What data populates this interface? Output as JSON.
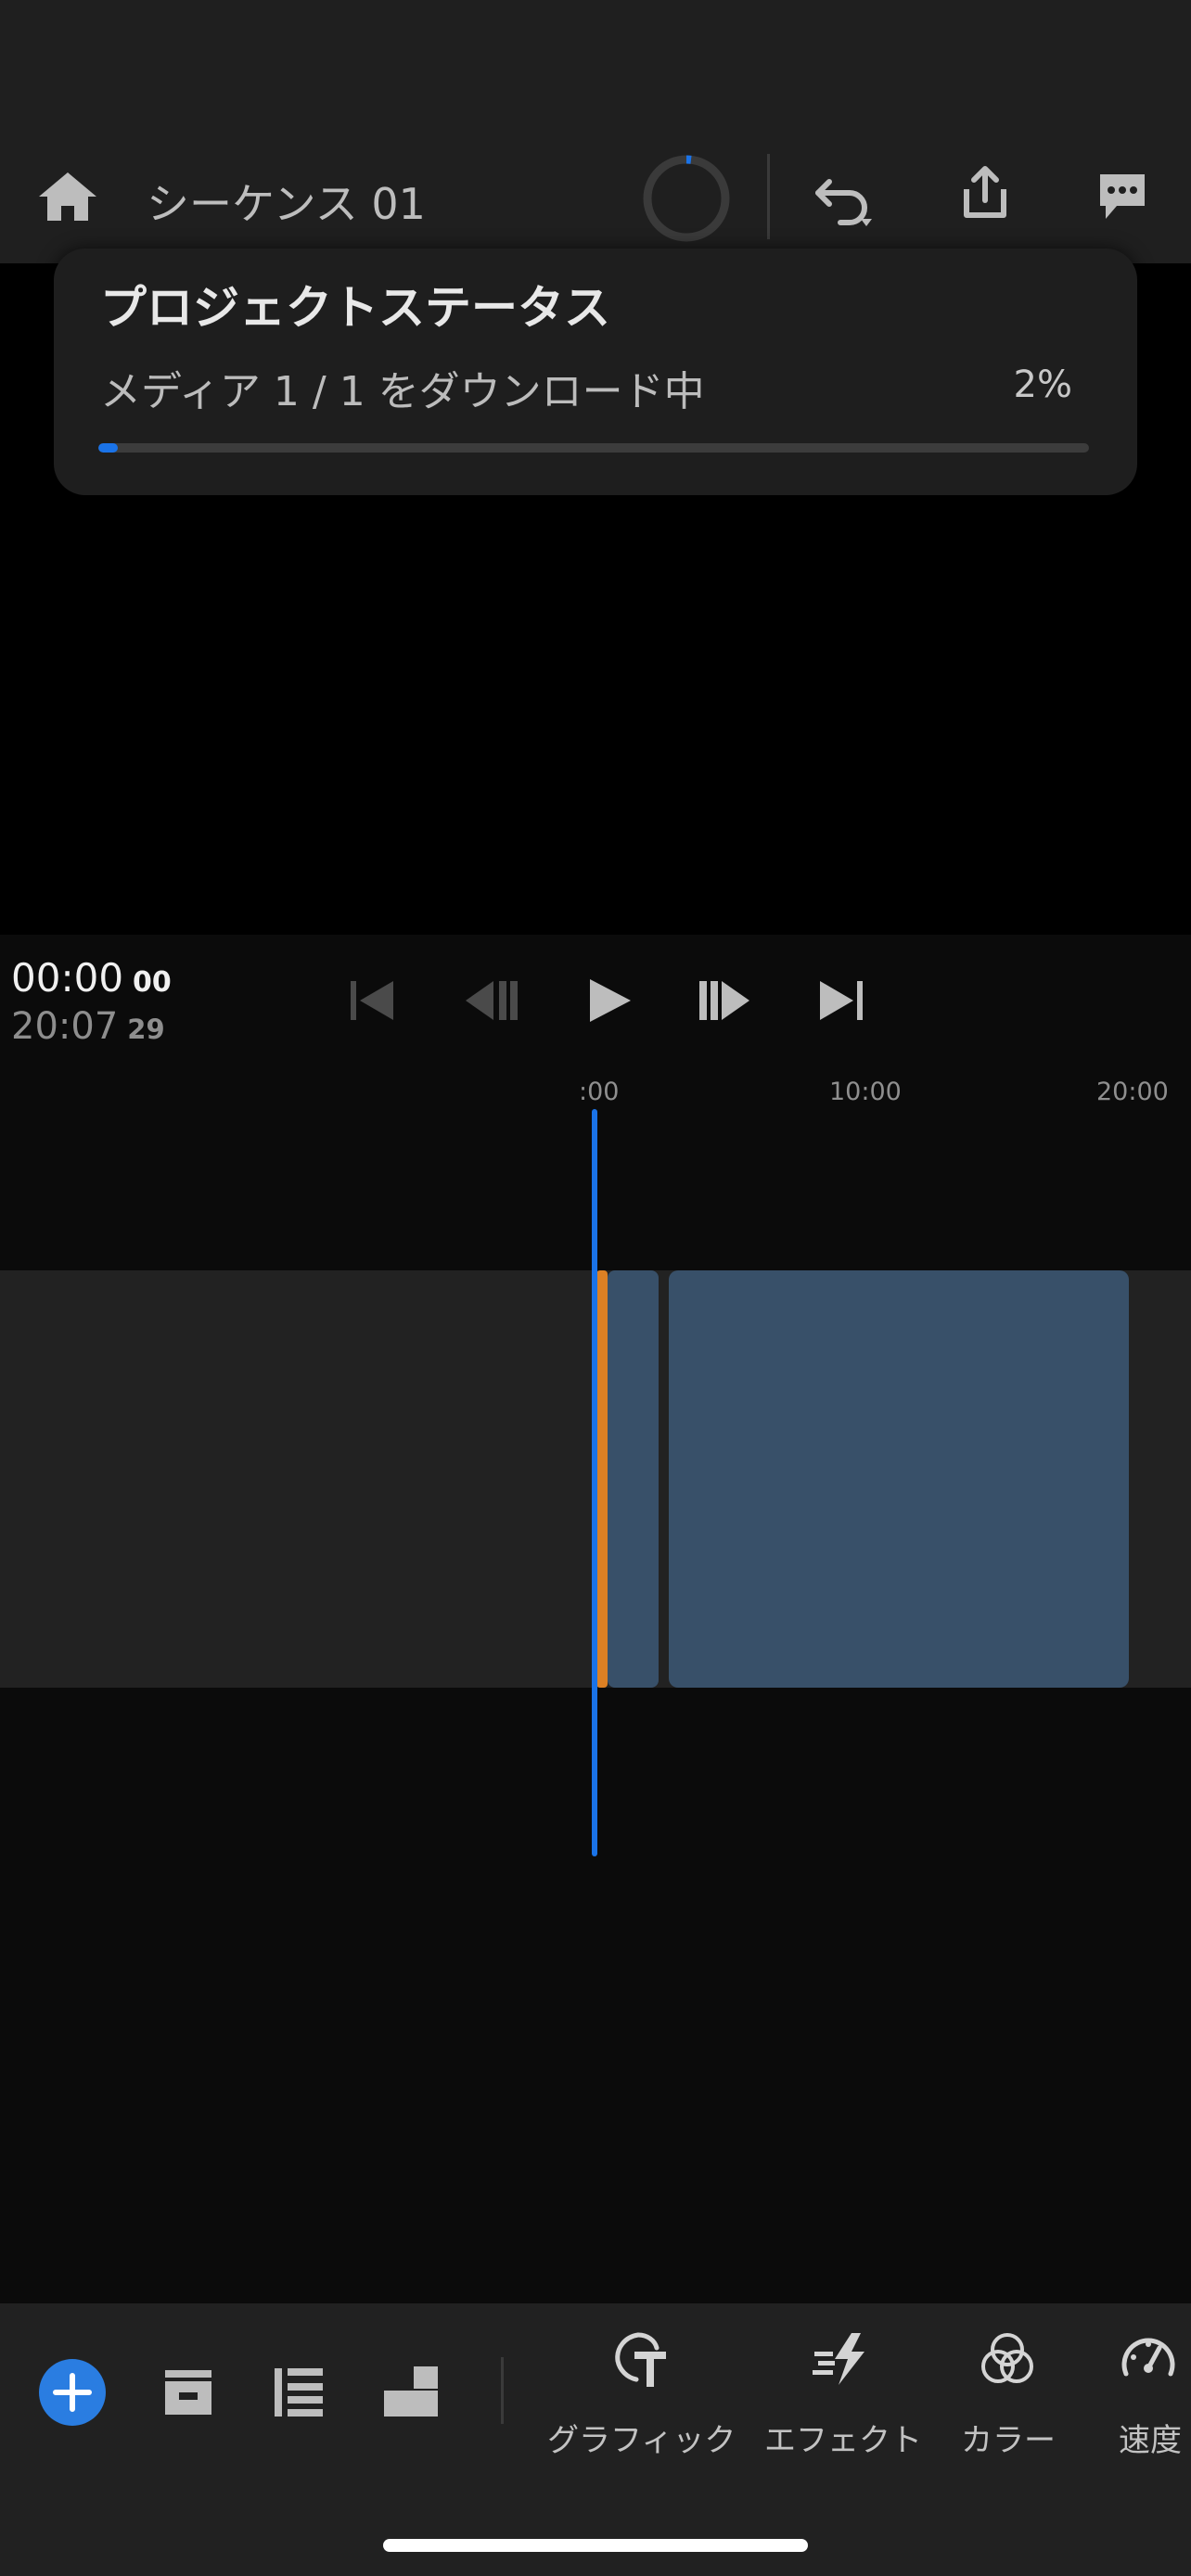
{
  "header": {
    "sequence_title": "シーケンス 01",
    "icons": [
      "home-icon",
      "sync-progress-ring-icon",
      "undo-icon",
      "share-icon",
      "comments-icon"
    ]
  },
  "project_status": {
    "title": "プロジェクトステータス",
    "message": "メディア 1 / 1 をダウンロード中",
    "percent_label": "2%",
    "progress": 0.02
  },
  "playback": {
    "current_time": "00:00",
    "current_frames": "00",
    "duration_time": "20:07",
    "duration_frames": "29",
    "controls": [
      "skip-to-start-icon",
      "step-back-icon",
      "play-icon",
      "step-forward-icon",
      "skip-to-end-icon"
    ]
  },
  "timeline": {
    "ruler_labels": [
      ":00",
      "10:00",
      "20:00"
    ]
  },
  "bottom_toolbar": {
    "left_icons": [
      "add-icon",
      "archive-icon",
      "list-icon",
      "aspect-ratio-icon"
    ],
    "tools": [
      {
        "label": "グラフィック",
        "icon": "graphics-icon"
      },
      {
        "label": "エフェクト",
        "icon": "effects-icon"
      },
      {
        "label": "カラー",
        "icon": "color-icon"
      },
      {
        "label": "速度",
        "icon": "speed-icon"
      }
    ]
  },
  "colors": {
    "accent": "#1a73e8",
    "clip": "#385069",
    "marker": "#dc8024"
  }
}
